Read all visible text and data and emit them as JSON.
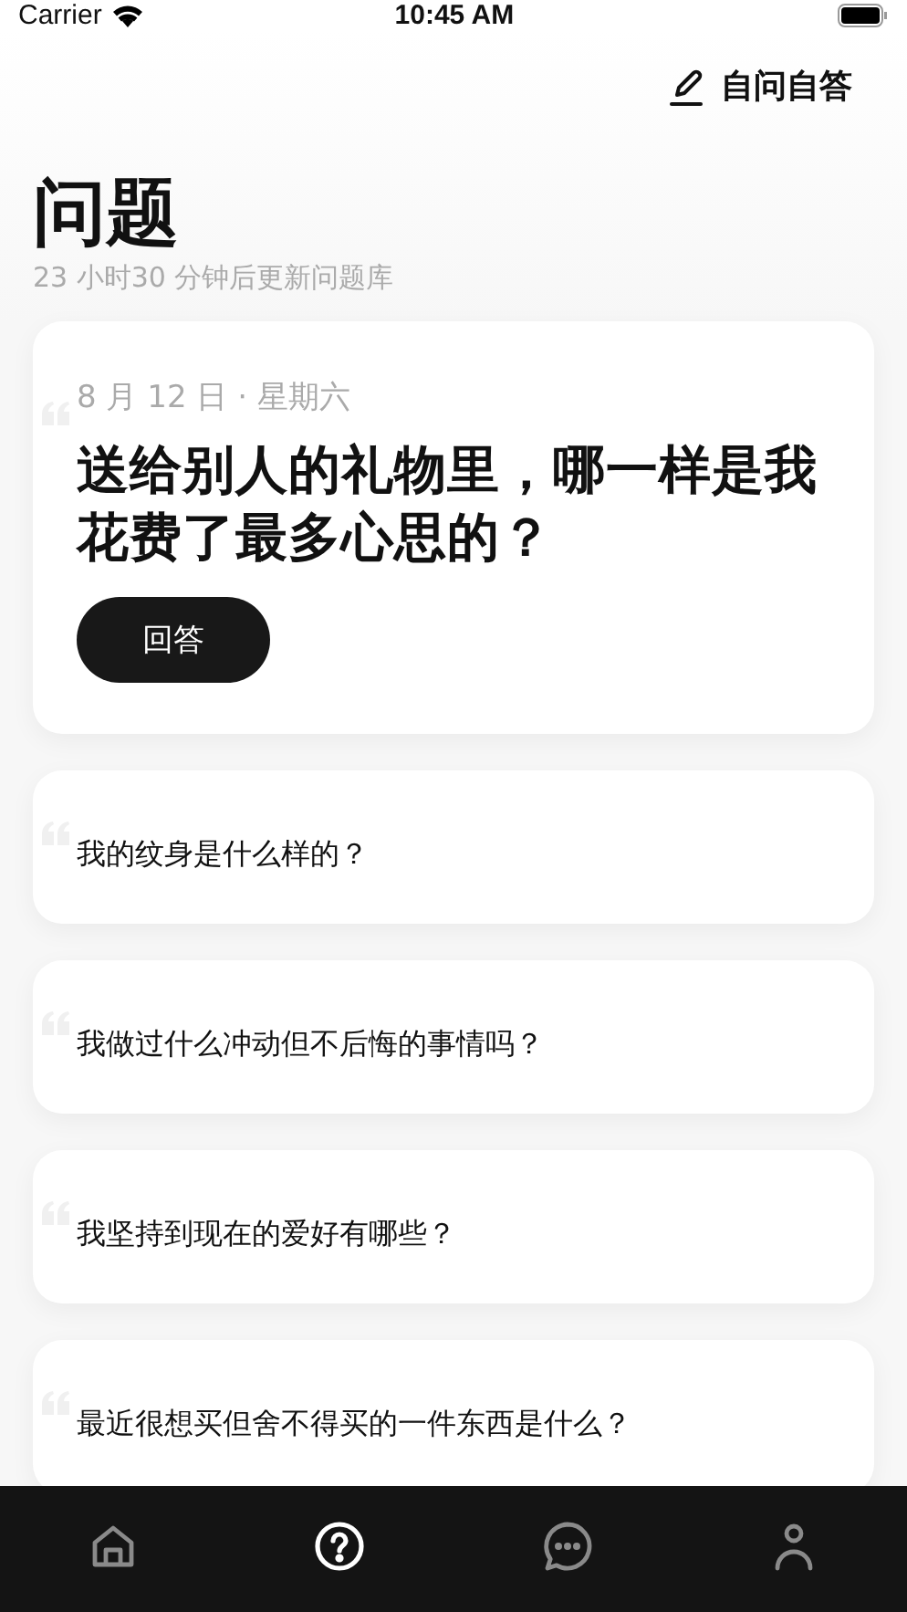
{
  "status_bar": {
    "carrier": "Carrier",
    "time": "10:45 AM"
  },
  "header": {
    "action": "自问自答"
  },
  "title": "问题",
  "subtitle": "23 小时30 分钟后更新问题库",
  "featured": {
    "date": "8 月 12 日 · 星期六",
    "question": "送给别人的礼物里，哪一样是我花费了最多心思的？",
    "button": "回答"
  },
  "questions": [
    {
      "text": "我的纹身是什么样的？"
    },
    {
      "text": "我做过什么冲动但不后悔的事情吗？"
    },
    {
      "text": "我坚持到现在的爱好有哪些？"
    },
    {
      "text": "最近很想买但舍不得买的一件东西是什么？"
    }
  ],
  "tab_bar": [
    {
      "kind": "home",
      "selected": false
    },
    {
      "kind": "question",
      "selected": true
    },
    {
      "kind": "chat",
      "selected": false
    },
    {
      "kind": "profile",
      "selected": false
    }
  ]
}
